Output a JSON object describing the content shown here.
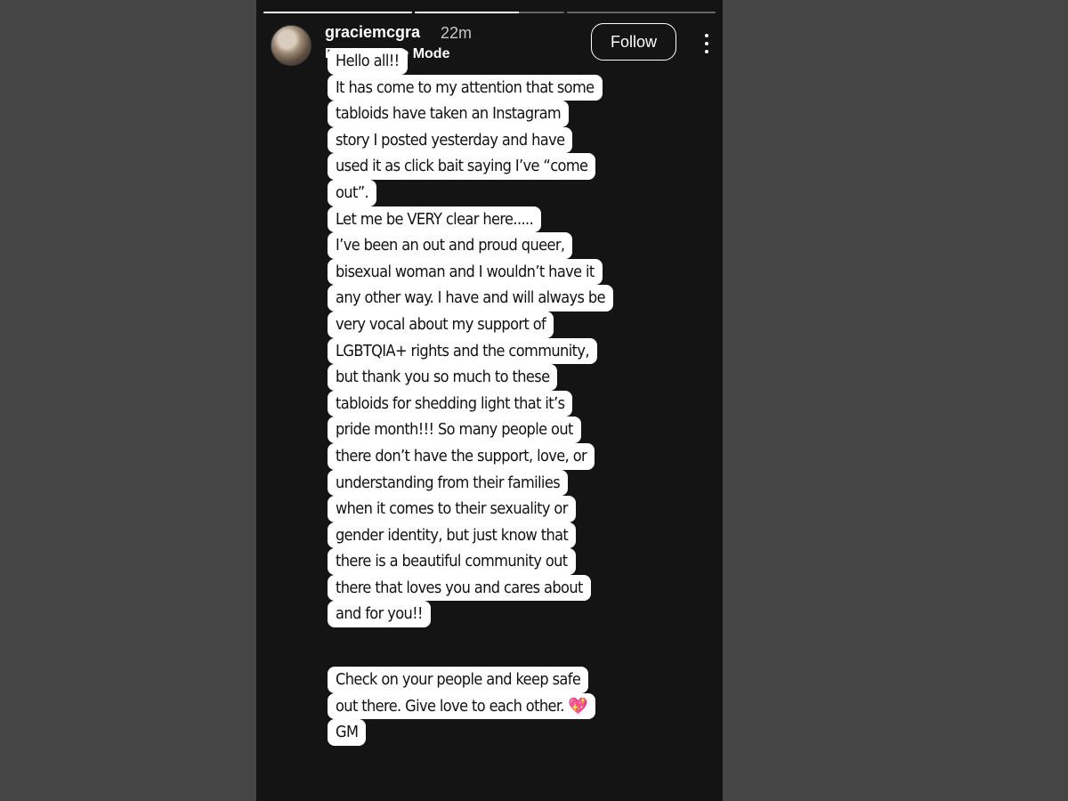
{
  "story": {
    "username": "graciemcgra",
    "time_ago": "22m",
    "subtitle": "From Create Mode",
    "follow_label": "Follow",
    "progress": [
      1,
      0.7,
      0
    ],
    "message_lines": [
      "Hello all!!",
      "It has come to my attention that some",
      "tabloids have taken an Instagram",
      "story I posted yesterday and have",
      "used it as click bait saying I’ve “come",
      "out”.",
      "Let me be VERY clear here.....",
      "I’ve been an out and proud queer,",
      "bisexual woman and I wouldn’t have it",
      "any other way. I have and will always be",
      "very vocal about my support of",
      "LGBTQIA+ rights and the community,",
      "but thank you so much to these",
      "tabloids for shedding light that it’s",
      "pride month!!! So many people out",
      "there don’t have the support, love, or",
      "understanding from their families",
      "when it comes to their sexuality or",
      "gender identity, but just know that",
      "there is a beautiful community out",
      "there that loves you and cares about",
      "and for you!!"
    ],
    "closing_lines": [
      "Check on your people and keep safe",
      "out there. Give love to each other.",
      "GM"
    ],
    "closing_emoji": "💖"
  },
  "icons": {
    "avatar": "profile-photo",
    "more": "vertical-ellipsis-icon"
  }
}
